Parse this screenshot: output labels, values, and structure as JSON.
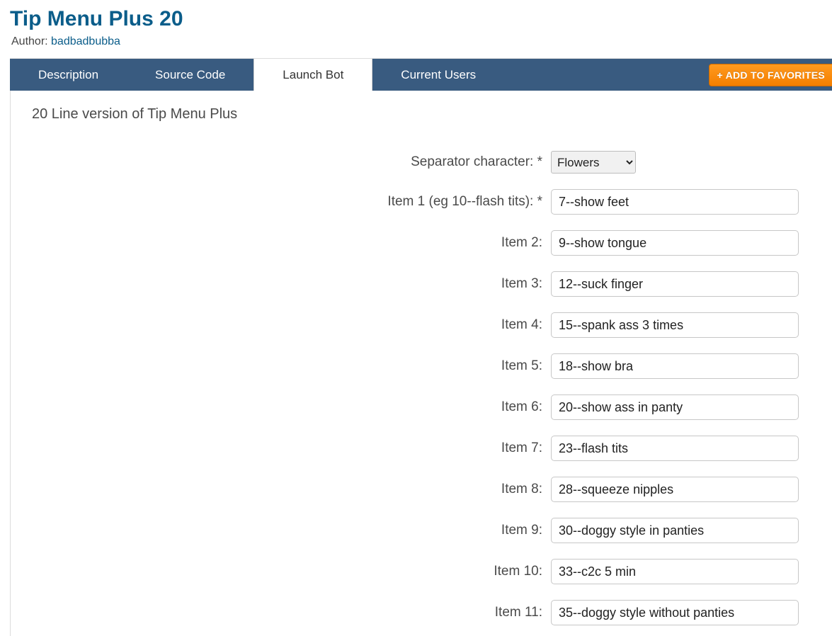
{
  "header": {
    "title": "Tip Menu Plus 20",
    "author_prefix": "Author: ",
    "author_name": "badbadbubba"
  },
  "tabs": {
    "items": [
      {
        "label": "Description",
        "active": false
      },
      {
        "label": "Source Code",
        "active": false
      },
      {
        "label": "Launch Bot",
        "active": true
      },
      {
        "label": "Current Users",
        "active": false
      }
    ],
    "favorites_label": "+ ADD TO FAVORITES"
  },
  "content": {
    "description": "20 Line version of Tip Menu Plus"
  },
  "form": {
    "separator": {
      "label": "Separator character: *",
      "value": "Flowers"
    },
    "items": [
      {
        "label": "Item 1 (eg 10--flash tits): *",
        "value": "7--show feet"
      },
      {
        "label": "Item 2:",
        "value": "9--show tongue"
      },
      {
        "label": "Item 3:",
        "value": "12--suck finger"
      },
      {
        "label": "Item 4:",
        "value": "15--spank ass 3 times"
      },
      {
        "label": "Item 5:",
        "value": "18--show bra"
      },
      {
        "label": "Item 6:",
        "value": "20--show ass in panty"
      },
      {
        "label": "Item 7:",
        "value": "23--flash tits"
      },
      {
        "label": "Item 8:",
        "value": "28--squeeze nipples"
      },
      {
        "label": "Item 9:",
        "value": "30--doggy style in panties"
      },
      {
        "label": "Item 10:",
        "value": "33--c2c 5 min"
      },
      {
        "label": "Item 11:",
        "value": "35--doggy style without panties"
      }
    ]
  }
}
